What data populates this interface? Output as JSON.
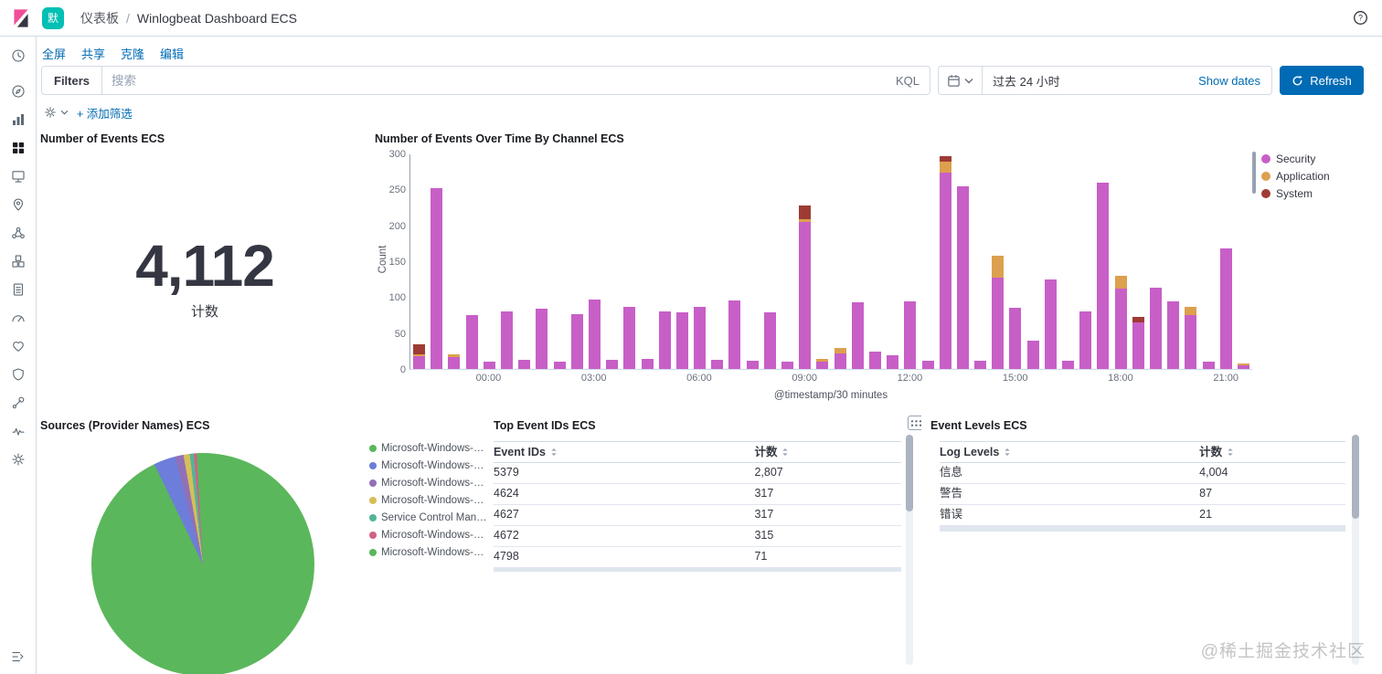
{
  "colors": {
    "primary_button": "#006BB4",
    "link": "#006BB4",
    "space_badge": "#00BFB3"
  },
  "header": {
    "space_initial": "默",
    "breadcrumb": {
      "root": "仪表板",
      "separator": "/",
      "current": "Winlogbeat Dashboard ECS"
    }
  },
  "sidebar": {
    "items": [
      {
        "icon": "recently-viewed-icon"
      },
      {
        "icon": "discover-icon"
      },
      {
        "icon": "visualize-icon"
      },
      {
        "icon": "dashboard-icon",
        "active": true
      },
      {
        "icon": "canvas-icon"
      },
      {
        "icon": "maps-icon"
      },
      {
        "icon": "machine-learning-icon"
      },
      {
        "icon": "metrics-icon"
      },
      {
        "icon": "logs-icon"
      },
      {
        "icon": "apm-icon"
      },
      {
        "icon": "uptime-icon"
      },
      {
        "icon": "siem-icon"
      },
      {
        "icon": "dev-tools-icon"
      },
      {
        "icon": "stack-monitoring-icon"
      },
      {
        "icon": "management-icon"
      }
    ]
  },
  "toolbar": {
    "links": [
      "全屏",
      "共享",
      "克隆",
      "编辑"
    ]
  },
  "query_bar": {
    "filters_label": "Filters",
    "search_placeholder": "搜索",
    "kql_label": "KQL",
    "time_range": "过去 24 小时",
    "show_dates_label": "Show dates",
    "refresh_label": "Refresh"
  },
  "filter_bar": {
    "add_filter_label": "+ 添加筛选"
  },
  "panels": {
    "metric": {
      "title": "Number of Events ECS",
      "value": "4,112",
      "label": "计数"
    },
    "events_over_time": {
      "title": "Number of Events Over Time By Channel ECS"
    },
    "sources": {
      "title": "Sources (Provider Names) ECS"
    },
    "top_event_ids": {
      "title": "Top Event IDs ECS"
    },
    "event_levels": {
      "title": "Event Levels ECS"
    }
  },
  "watermark": "@稀土掘金技术社区",
  "chart_data": [
    {
      "panel": "events_over_time",
      "type": "bar",
      "stacked": true,
      "title": "Number of Events Over Time By Channel ECS",
      "xlabel": "@timestamp/30 minutes",
      "ylabel": "Count",
      "ylim": [
        0,
        300
      ],
      "y_ticks": [
        0,
        50,
        100,
        150,
        200,
        250,
        300
      ],
      "grid": false,
      "legend_position": "right",
      "x": [
        "22:00",
        "22:30",
        "23:00",
        "23:30",
        "00:00",
        "00:30",
        "01:00",
        "01:30",
        "02:00",
        "02:30",
        "03:00",
        "03:30",
        "04:00",
        "04:30",
        "05:00",
        "05:30",
        "06:00",
        "06:30",
        "07:00",
        "07:30",
        "08:00",
        "08:30",
        "09:00",
        "09:30",
        "10:00",
        "10:30",
        "11:00",
        "11:30",
        "12:00",
        "12:30",
        "13:00",
        "13:30",
        "14:00",
        "14:30",
        "15:00",
        "15:30",
        "16:00",
        "16:30",
        "17:00",
        "17:30",
        "18:00",
        "18:30",
        "19:00",
        "19:30",
        "20:00",
        "20:30",
        "21:00",
        "21:30"
      ],
      "x_ticks": [
        "00:00",
        "03:00",
        "06:00",
        "09:00",
        "12:00",
        "15:00",
        "18:00",
        "21:00"
      ],
      "series": [
        {
          "name": "Security",
          "color": "#C75FC7",
          "values": [
            18,
            253,
            16,
            75,
            10,
            80,
            13,
            84,
            10,
            77,
            97,
            13,
            87,
            14,
            81,
            79,
            87,
            13,
            96,
            11,
            79,
            10,
            205,
            10,
            22,
            93,
            24,
            19,
            95,
            12,
            275,
            255,
            12,
            128,
            85,
            40,
            125,
            12,
            80,
            260,
            112,
            65,
            113,
            95,
            75,
            10,
            168,
            5
          ]
        },
        {
          "name": "Application",
          "color": "#DCA04F",
          "values": [
            3,
            0,
            5,
            0,
            0,
            0,
            0,
            0,
            0,
            0,
            0,
            0,
            0,
            0,
            0,
            0,
            0,
            0,
            0,
            0,
            0,
            0,
            5,
            4,
            8,
            0,
            0,
            0,
            0,
            0,
            15,
            0,
            0,
            30,
            0,
            0,
            0,
            0,
            0,
            0,
            18,
            0,
            0,
            0,
            12,
            0,
            0,
            3
          ]
        },
        {
          "name": "System",
          "color": "#9E3B34",
          "values": [
            14,
            0,
            0,
            0,
            0,
            0,
            0,
            0,
            0,
            0,
            0,
            0,
            0,
            0,
            0,
            0,
            0,
            0,
            0,
            0,
            0,
            0,
            18,
            0,
            0,
            0,
            0,
            0,
            0,
            0,
            8,
            0,
            0,
            0,
            0,
            0,
            0,
            0,
            0,
            0,
            0,
            8,
            0,
            0,
            0,
            0,
            0,
            0
          ]
        }
      ]
    },
    {
      "panel": "sources",
      "type": "pie",
      "title": "Sources (Provider Names) ECS",
      "unit": "percent",
      "slices": [
        {
          "label": "Microsoft-Windows-…",
          "color": "#5BB75B",
          "value": 92.8
        },
        {
          "label": "Microsoft-Windows-…",
          "color": "#6C7ED9",
          "value": 3.2
        },
        {
          "label": "Microsoft-Windows-…",
          "color": "#9170B8",
          "value": 1.2
        },
        {
          "label": "Microsoft-Windows-…",
          "color": "#D6BF57",
          "value": 0.9
        },
        {
          "label": "Service Control Man…",
          "color": "#54B399",
          "value": 0.6
        },
        {
          "label": "Microsoft-Windows-…",
          "color": "#D36086",
          "value": 0.4
        },
        {
          "label": "Microsoft-Windows-…",
          "color": "#5BB75B",
          "value": 0.9
        }
      ]
    },
    {
      "panel": "top_event_ids",
      "type": "table",
      "title": "Top Event IDs ECS",
      "columns": [
        "Event IDs",
        "计数"
      ],
      "rows": [
        [
          "5379",
          "2,807"
        ],
        [
          "4624",
          "317"
        ],
        [
          "4627",
          "317"
        ],
        [
          "4672",
          "315"
        ],
        [
          "4798",
          "71"
        ]
      ],
      "empty_rows": 4
    },
    {
      "panel": "event_levels",
      "type": "table",
      "title": "Event Levels ECS",
      "columns": [
        "Log Levels",
        "计数"
      ],
      "rows": [
        [
          "信息",
          "4,004"
        ],
        [
          "警告",
          "87"
        ],
        [
          "错误",
          "21"
        ]
      ],
      "empty_rows": 6
    }
  ]
}
